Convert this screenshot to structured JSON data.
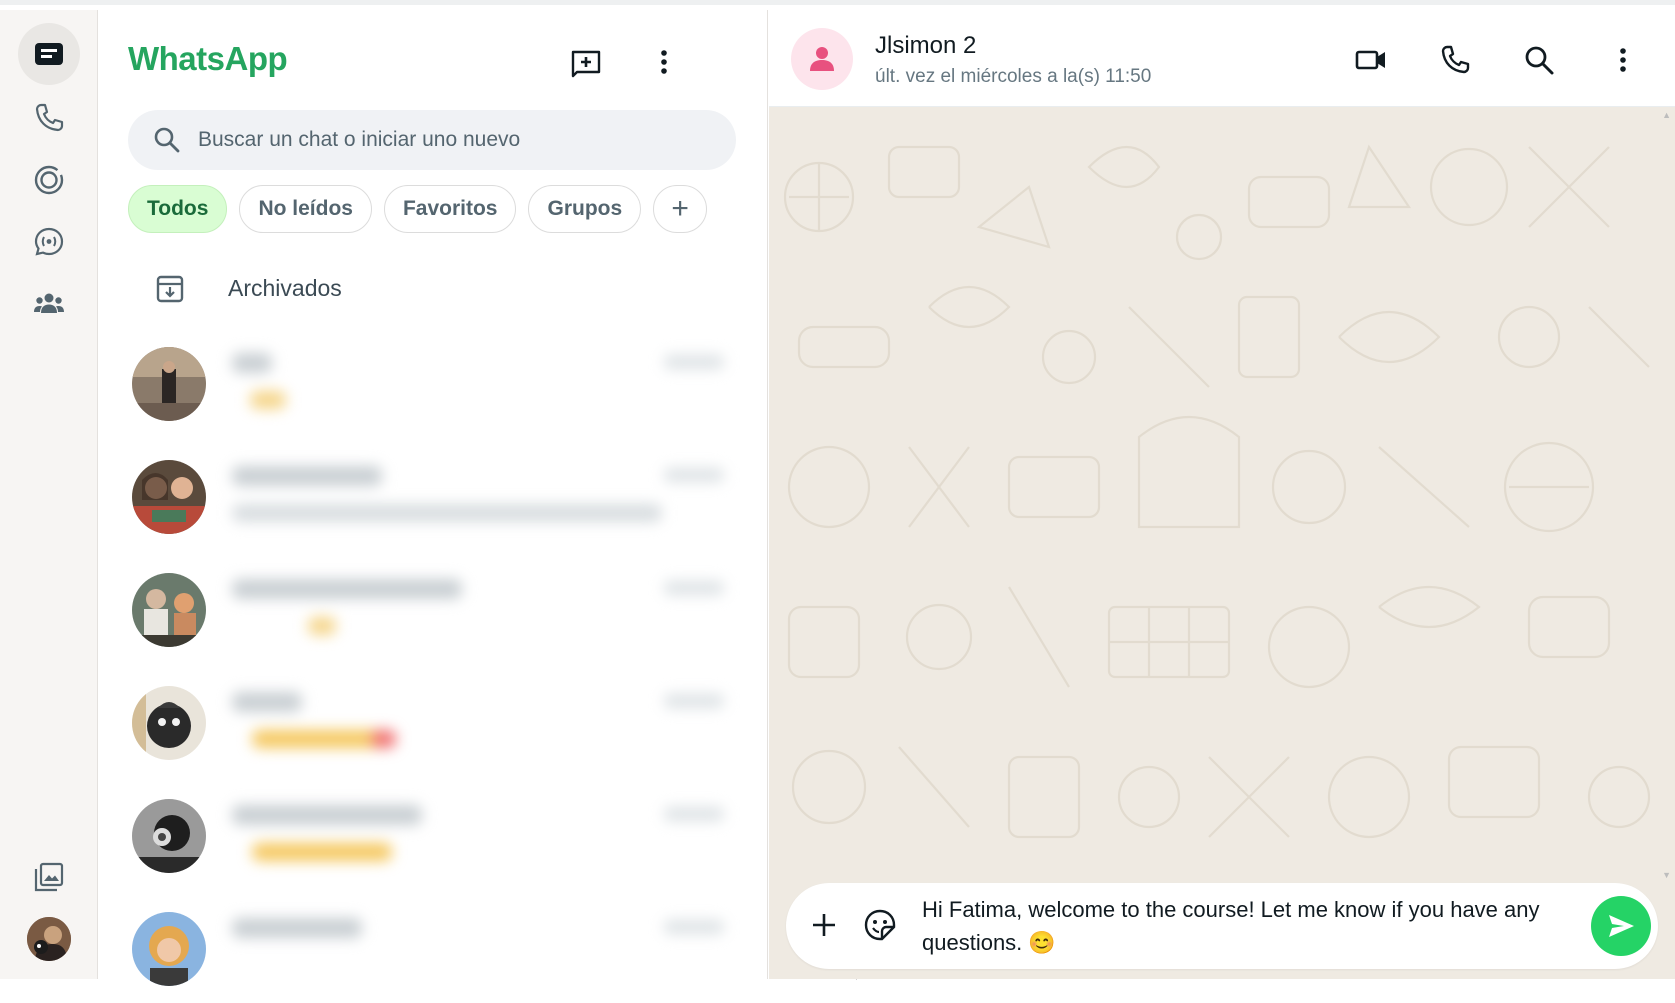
{
  "app": {
    "brand": "WhatsApp",
    "colors": {
      "accent": "#25d366",
      "brand_text": "#25a55f",
      "chip_active_bg": "#d9fdd3",
      "wallpaper": "#efeae2"
    }
  },
  "rail": {
    "items": [
      {
        "name": "chats",
        "icon": "chat-bubble-icon",
        "active": true
      },
      {
        "name": "calls",
        "icon": "phone-icon",
        "active": false
      },
      {
        "name": "status",
        "icon": "status-ring-icon",
        "active": false
      },
      {
        "name": "channels",
        "icon": "channels-icon",
        "active": false
      },
      {
        "name": "communities",
        "icon": "communities-icon",
        "active": false
      }
    ],
    "bottom": [
      {
        "name": "media",
        "icon": "media-gallery-icon"
      },
      {
        "name": "profile",
        "icon": "profile-avatar"
      }
    ]
  },
  "sidebar": {
    "search_placeholder": "Buscar un chat o iniciar uno nuevo",
    "filters": [
      "Todos",
      "No leídos",
      "Favoritos",
      "Grupos"
    ],
    "active_filter": "Todos",
    "archived_label": "Archivados"
  },
  "conversation": {
    "contact_name": "Jlsimon 2",
    "contact_status": "últ. vez el miércoles a la(s) 11:50",
    "draft_message": "Hi Fatima, welcome to the course! Let me know if you have any questions. 😊"
  }
}
